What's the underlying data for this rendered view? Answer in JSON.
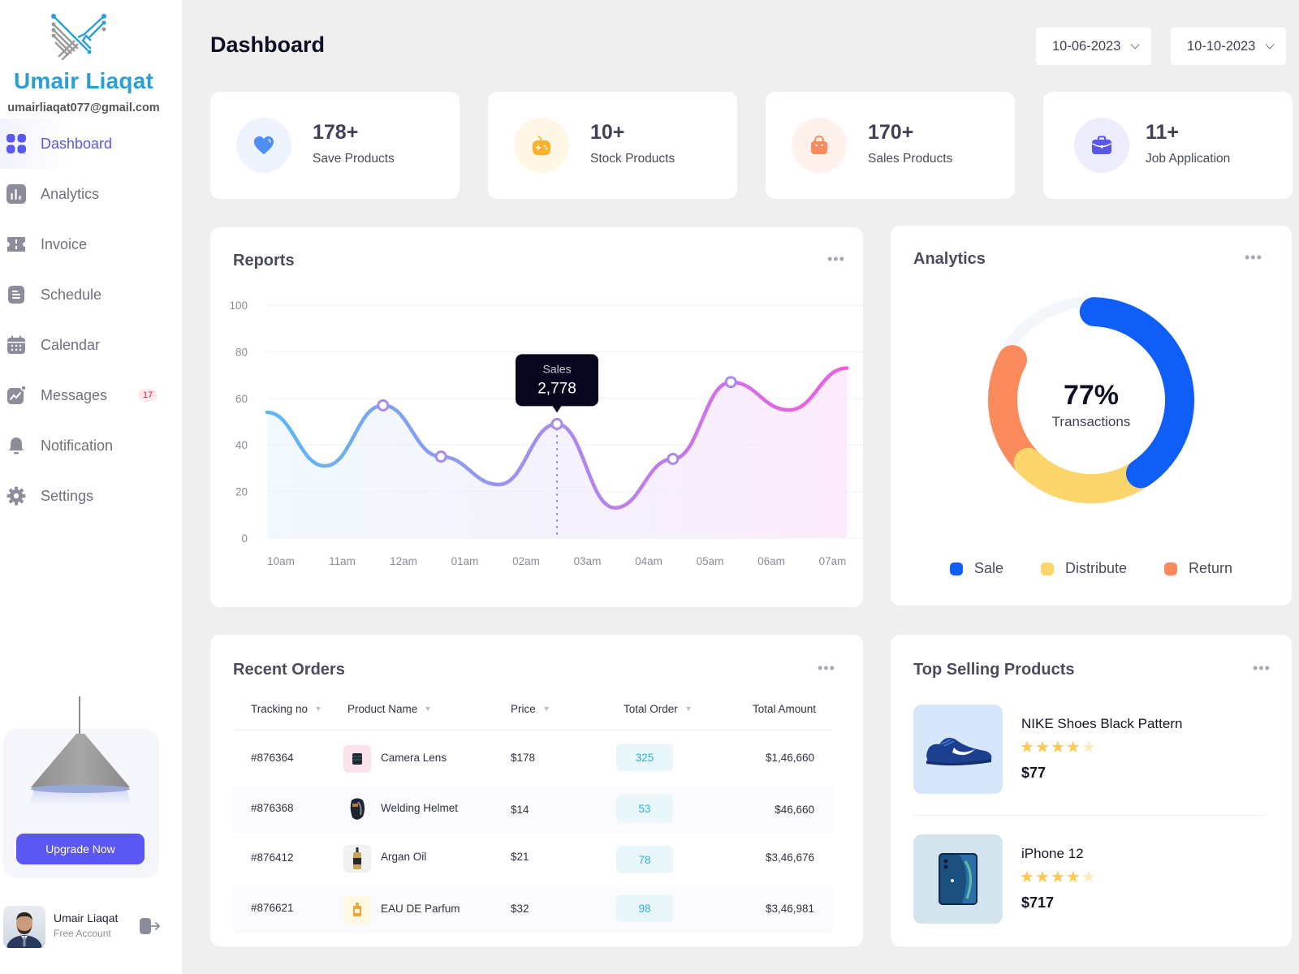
{
  "brand": {
    "name": "Umair Liaqat",
    "email": "umairliaqat077@gmail.com"
  },
  "sidebar": {
    "items": [
      {
        "label": "Dashboard",
        "icon": "grid-icon",
        "active": true
      },
      {
        "label": "Analytics",
        "icon": "bar-chart-icon"
      },
      {
        "label": "Invoice",
        "icon": "invoice-icon"
      },
      {
        "label": "Schedule",
        "icon": "document-icon"
      },
      {
        "label": "Calendar",
        "icon": "calendar-icon"
      },
      {
        "label": "Messages",
        "icon": "trend-chart-icon",
        "badge": "17"
      },
      {
        "label": "Notification",
        "icon": "bell-icon"
      },
      {
        "label": "Settings",
        "icon": "gear-icon"
      }
    ],
    "upgrade_label": "Upgrade Now",
    "profile": {
      "name": "Umair Liaqat",
      "plan": "Free Account"
    }
  },
  "header": {
    "title": "Dashboard",
    "date_from": "10-06-2023",
    "date_to": "10-10-2023"
  },
  "stats": [
    {
      "value": "178+",
      "label": "Save Products",
      "icon": "heart-icon",
      "color": "#4f8ef7",
      "bg": "#eef3fd"
    },
    {
      "value": "10+",
      "label": "Stock Products",
      "icon": "gamepad-icon",
      "color": "#f7b32b",
      "bg": "#fff7e6"
    },
    {
      "value": "170+",
      "label": "Sales Products",
      "icon": "shopping-bag-icon",
      "color": "#fb8a5c",
      "bg": "#fff1ec"
    },
    {
      "value": "11+",
      "label": "Job Application",
      "icon": "briefcase-icon",
      "color": "#5b57e6",
      "bg": "#eeedfd"
    }
  ],
  "reports": {
    "title": "Reports",
    "tooltip": {
      "label": "Sales",
      "value": "2,778"
    }
  },
  "analytics": {
    "title": "Analytics",
    "center_value": "77%",
    "center_label": "Transactions"
  },
  "orders": {
    "title": "Recent Orders",
    "columns": [
      "Tracking no",
      "Product Name",
      "Price",
      "Total Order",
      "Total Amount"
    ],
    "rows": [
      {
        "tracking": "#876364",
        "product": "Camera Lens",
        "price": "$178",
        "total_order": "325",
        "total_amount": "$1,46,660",
        "thumb": "camera-lens-image",
        "thumb_bg": "#fbe3ee"
      },
      {
        "tracking": "#876368",
        "product": "Welding Helmet",
        "price": "$14",
        "total_order": "53",
        "total_amount": "$46,660",
        "thumb": "welding-helmet-image",
        "thumb_bg": "#ffffff"
      },
      {
        "tracking": "#876412",
        "product": "Argan Oil",
        "price": "$21",
        "total_order": "78",
        "total_amount": "$3,46,676",
        "thumb": "argan-oil-image",
        "thumb_bg": "#f1f1f3"
      },
      {
        "tracking": "#876621",
        "product": "EAU DE Parfum",
        "price": "$32",
        "total_order": "98",
        "total_amount": "$3,46,981",
        "thumb": "perfume-image",
        "thumb_bg": "#fff8e3"
      }
    ]
  },
  "top_selling": {
    "title": "Top Selling Products",
    "products": [
      {
        "name": "NIKE Shoes Black Pattern",
        "rating": 4,
        "max_rating": 5,
        "price": "$77",
        "image": "sneaker-image",
        "bg": "#d6e6fb"
      },
      {
        "name": "iPhone 12",
        "rating": 4,
        "max_rating": 5,
        "price": "$717",
        "image": "phone-image",
        "bg": "#d3e4ef"
      }
    ]
  },
  "chart_data": [
    {
      "type": "line",
      "title": "Reports",
      "x": [
        "10am",
        "11am",
        "12am",
        "01am",
        "02am",
        "03am",
        "04am",
        "05am",
        "06am",
        "07am"
      ],
      "series": [
        {
          "name": "Sales",
          "values": [
            54,
            31,
            57,
            35,
            23,
            49,
            13,
            34,
            67,
            55,
            73
          ]
        }
      ],
      "markers": [
        2,
        3,
        5,
        7,
        8
      ],
      "highlight_index": 5,
      "ylim": [
        0,
        100
      ],
      "yticks": [
        0,
        20,
        40,
        60,
        80,
        100
      ],
      "grid": true,
      "gradient": [
        "#5ab8f5",
        "#a98af0",
        "#f25ce2"
      ]
    },
    {
      "type": "pie",
      "title": "Analytics",
      "labels": [
        "Sale",
        "Distribute",
        "Return"
      ],
      "values": [
        40,
        22,
        20
      ],
      "colors": [
        "#0f5ef7",
        "#fcd56b",
        "#fb8a5c"
      ],
      "center_text": "77%",
      "legend": "bottom"
    }
  ]
}
